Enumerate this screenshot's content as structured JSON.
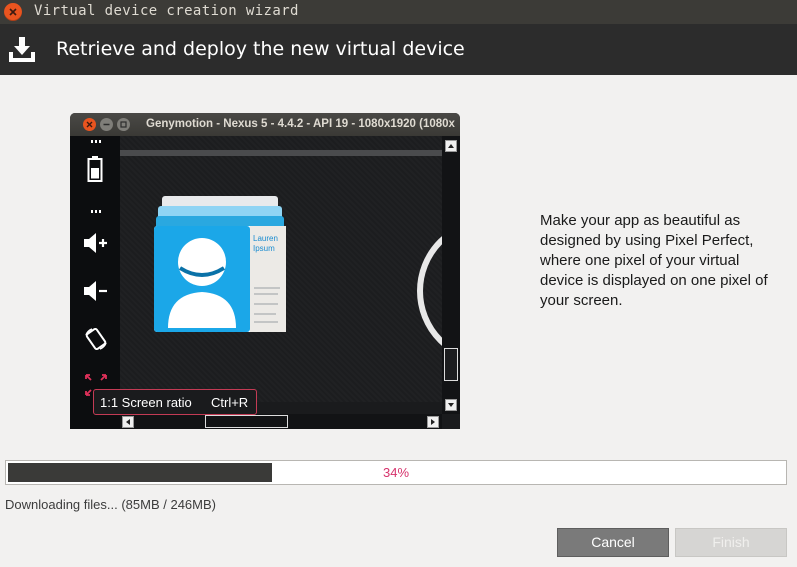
{
  "window": {
    "title": "Virtual device creation wizard"
  },
  "header": {
    "icon": "download-icon",
    "title": "Retrieve and deploy the new virtual device"
  },
  "preview": {
    "window_title": "Genymotion - Nexus 5 - 4.4.2 - API 19 - 1080x1920 (1080x",
    "contact_card": {
      "first_name": "Lauren",
      "last_name": "Ipsum"
    },
    "sidebar_icons": [
      "battery-icon",
      "volume-up-icon",
      "volume-down-icon",
      "rotate-icon",
      "screen-ratio-icon"
    ],
    "tooltip": {
      "label": "1:1 Screen ratio",
      "shortcut": "Ctrl+R"
    }
  },
  "description": "Make your app as beautiful as designed by using Pixel Perfect, where one pixel of your virtual device is displayed on one pixel of your screen.",
  "progress": {
    "percent": 34,
    "label": "34%",
    "status": "Downloading files... (85MB / 246MB)"
  },
  "buttons": {
    "cancel": "Cancel",
    "finish": "Finish"
  },
  "colors": {
    "header_bg": "#2c2c2c",
    "progress_fill": "#3a3a38",
    "progress_text": "#d6336c",
    "close_button": "#e9541f"
  }
}
